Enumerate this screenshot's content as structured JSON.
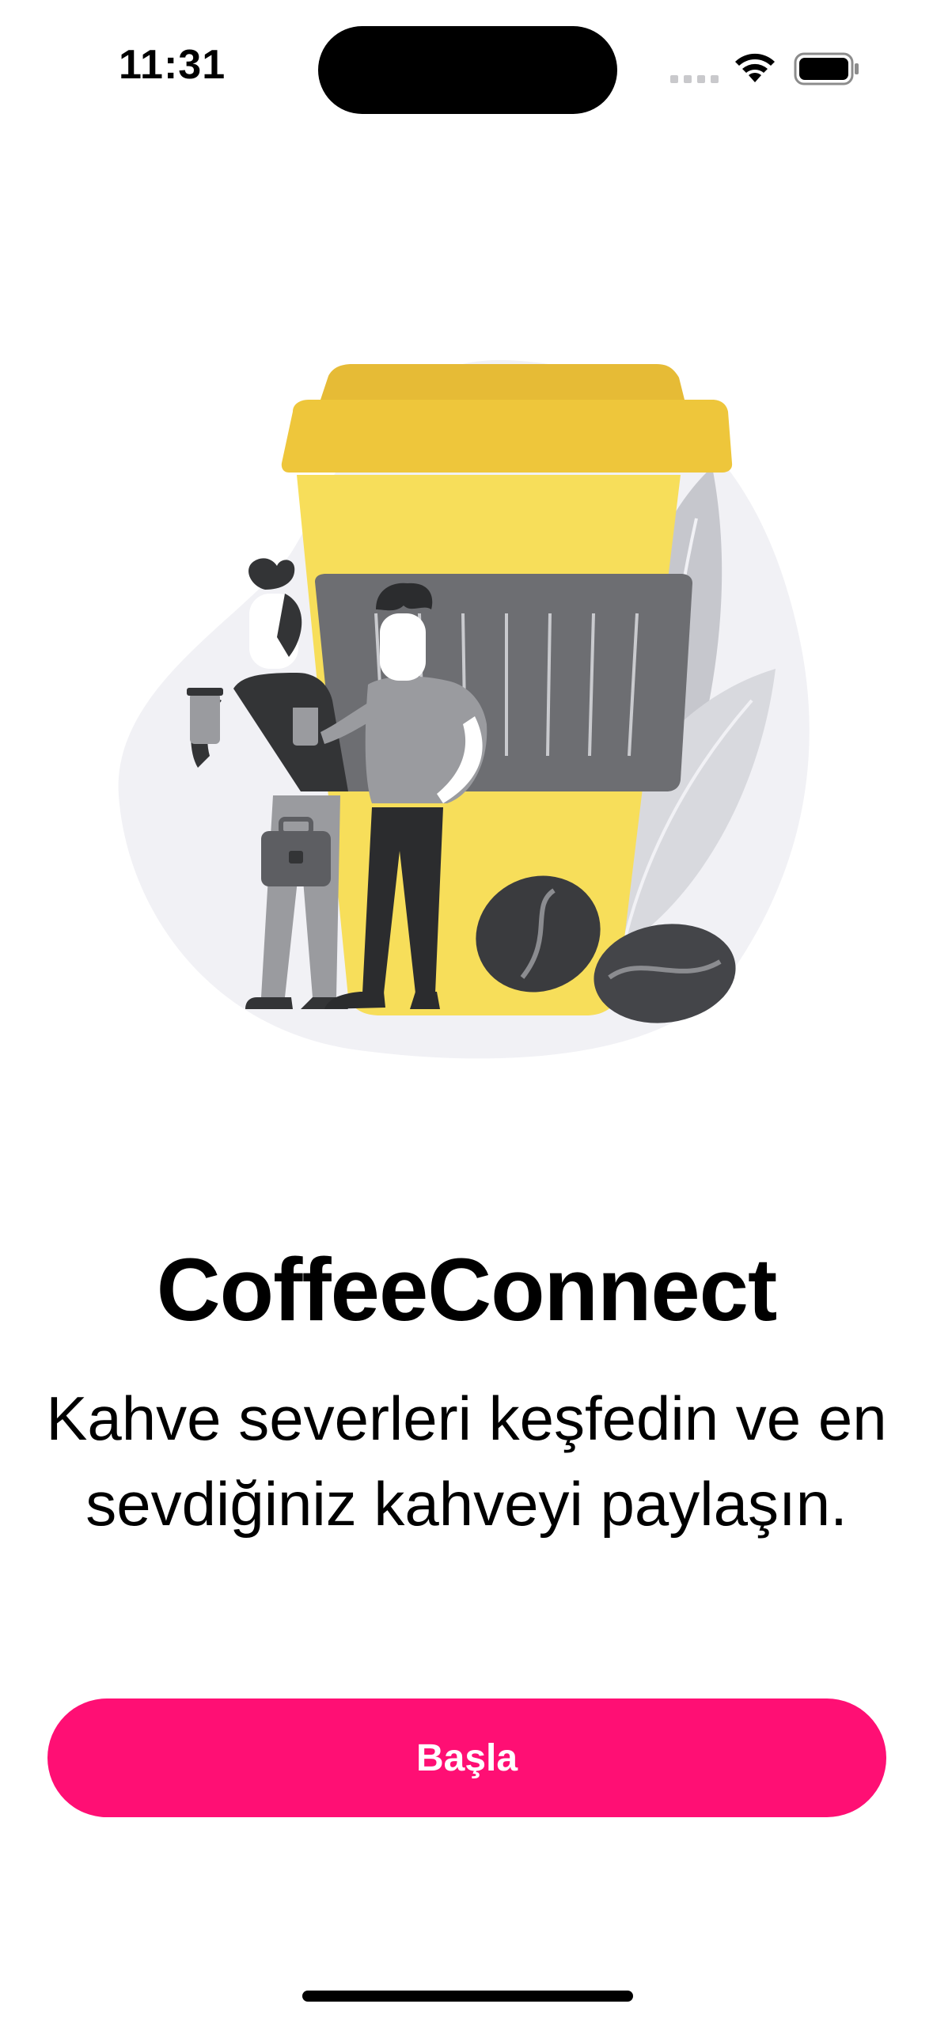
{
  "status_bar": {
    "time": "11:31"
  },
  "app": {
    "title": "CoffeeConnect",
    "tagline": "Kahve severleri keşfedin ve en sevdiğiniz kahveyi paylaşın.",
    "start_label": "Başla"
  },
  "illustration": {
    "icon": "coffee-cup-people-illustration"
  },
  "colors": {
    "accent": "#ff0f74",
    "cup_yellow": "#f7de5a",
    "lid": "#eec63b",
    "sleeve": "#6d6e72"
  }
}
